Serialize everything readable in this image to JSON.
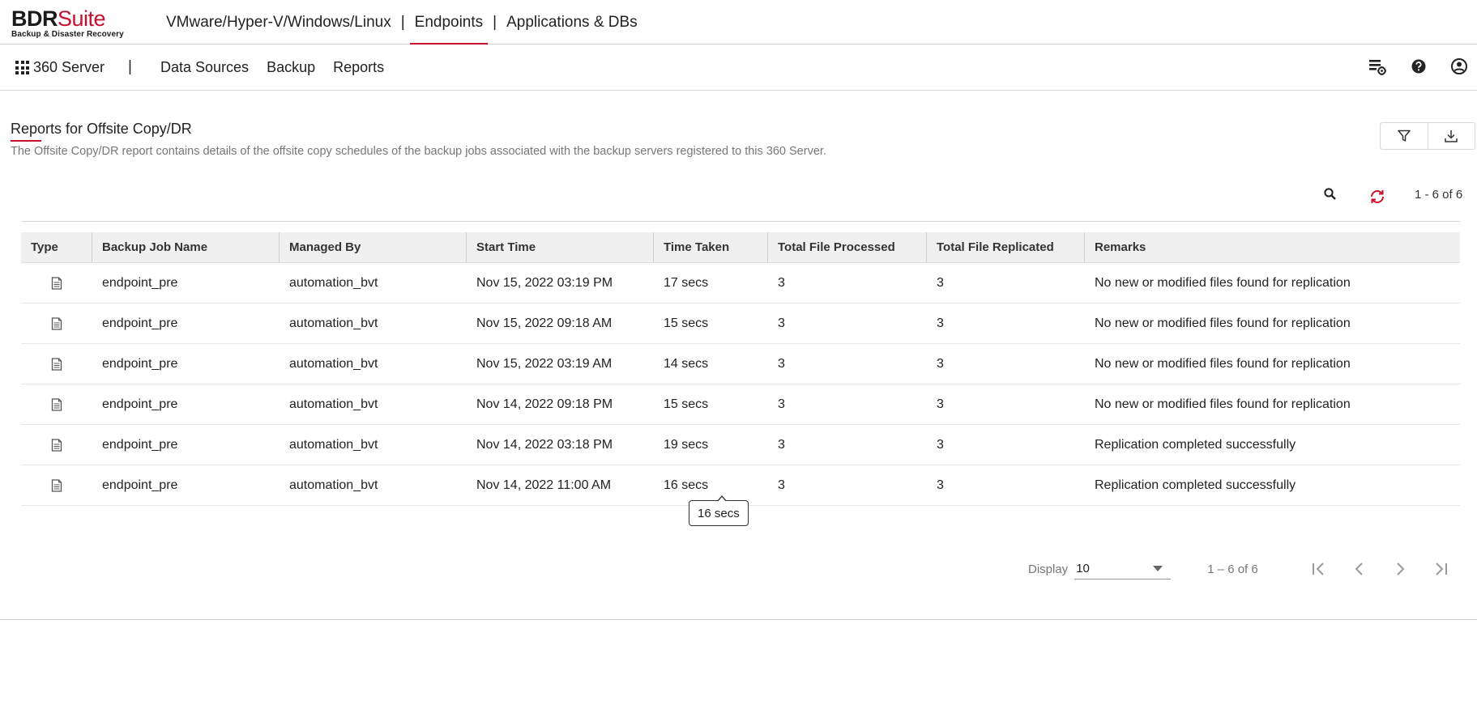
{
  "brand": {
    "name_main": "BDR",
    "name_accent": "Suite",
    "tagline": "Backup & Disaster Recovery",
    "accent_color": "#c8102e"
  },
  "top_nav": {
    "items": [
      {
        "label": "VMware/Hyper-V/Windows/Linux",
        "active": false
      },
      {
        "label": "Endpoints",
        "active": true
      },
      {
        "label": "Applications & DBs",
        "active": false
      }
    ],
    "separator": "|"
  },
  "sub_nav": {
    "apps_label": "360 Server",
    "separator": "|",
    "items": [
      "Data Sources",
      "Backup",
      "Reports"
    ],
    "icons": [
      "server-settings-icon",
      "help-icon",
      "user-account-icon"
    ]
  },
  "report": {
    "title": "Reports for Offsite Copy/DR",
    "description": "The Offsite Copy/DR report contains details of the offsite copy schedules of the backup jobs associated with the backup servers registered to this 360 Server.",
    "count_label": "1 - 6 of 6"
  },
  "table": {
    "columns": [
      "Type",
      "Backup Job Name",
      "Managed By",
      "Start Time",
      "Time Taken",
      "Total File Processed",
      "Total File Replicated",
      "Remarks"
    ],
    "rows": [
      {
        "job": "endpoint_pre",
        "managed_by": "automation_bvt",
        "start_time": "Nov 15, 2022 03:19 PM",
        "time_taken": "17 secs",
        "processed": "3",
        "replicated": "3",
        "remarks": "No new or modified files found for replication"
      },
      {
        "job": "endpoint_pre",
        "managed_by": "automation_bvt",
        "start_time": "Nov 15, 2022 09:18 AM",
        "time_taken": "15 secs",
        "processed": "3",
        "replicated": "3",
        "remarks": "No new or modified files found for replication"
      },
      {
        "job": "endpoint_pre",
        "managed_by": "automation_bvt",
        "start_time": "Nov 15, 2022 03:19 AM",
        "time_taken": "14 secs",
        "processed": "3",
        "replicated": "3",
        "remarks": "No new or modified files found for replication"
      },
      {
        "job": "endpoint_pre",
        "managed_by": "automation_bvt",
        "start_time": "Nov 14, 2022 09:18 PM",
        "time_taken": "15 secs",
        "processed": "3",
        "replicated": "3",
        "remarks": "No new or modified files found for replication"
      },
      {
        "job": "endpoint_pre",
        "managed_by": "automation_bvt",
        "start_time": "Nov 14, 2022 03:18 PM",
        "time_taken": "19 secs",
        "processed": "3",
        "replicated": "3",
        "remarks": "Replication completed successfully"
      },
      {
        "job": "endpoint_pre",
        "managed_by": "automation_bvt",
        "start_time": "Nov 14, 2022 11:00 AM",
        "time_taken": "16 secs",
        "processed": "3",
        "replicated": "3",
        "remarks": "Replication completed successfully"
      }
    ]
  },
  "tooltip": {
    "text": "16 secs"
  },
  "pagination": {
    "display_label": "Display",
    "page_size": "10",
    "count_label": "1 – 6 of 6"
  }
}
